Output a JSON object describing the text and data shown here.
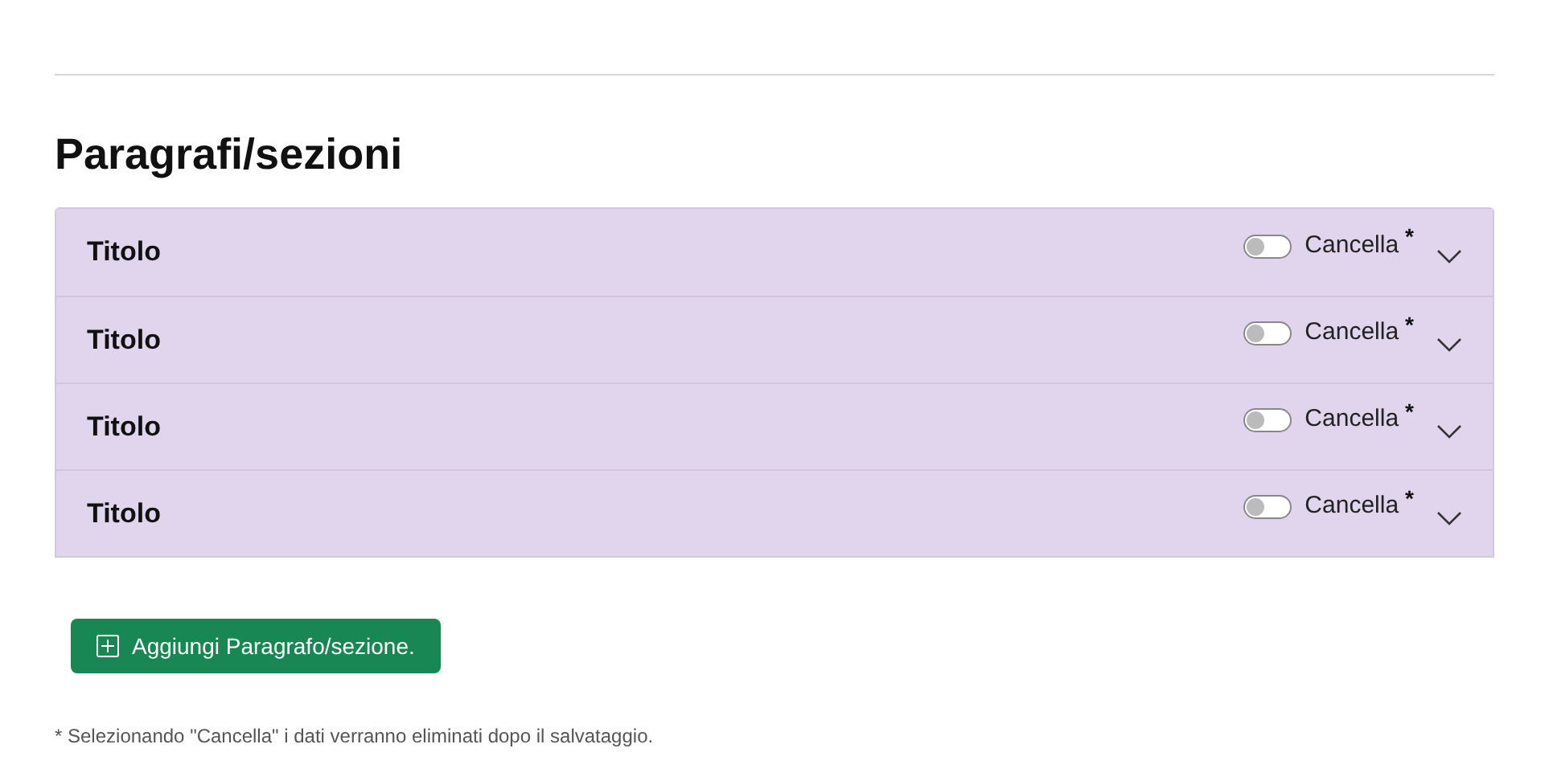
{
  "heading": "Paragrafi/sezioni",
  "sections": [
    {
      "title": "Titolo",
      "toggle_label": "Cancella",
      "toggle_mark": "*",
      "on": false,
      "expanded": false
    },
    {
      "title": "Titolo",
      "toggle_label": "Cancella",
      "toggle_mark": "*",
      "on": false,
      "expanded": false
    },
    {
      "title": "Titolo",
      "toggle_label": "Cancella",
      "toggle_mark": "*",
      "on": false,
      "expanded": false
    },
    {
      "title": "Titolo",
      "toggle_label": "Cancella",
      "toggle_mark": "*",
      "on": false,
      "expanded": false
    }
  ],
  "add_button": "Aggiungi Paragrafo/sezione.",
  "footnote": "* Selezionando \"Cancella\" i dati verranno eliminati dopo il salvataggio."
}
